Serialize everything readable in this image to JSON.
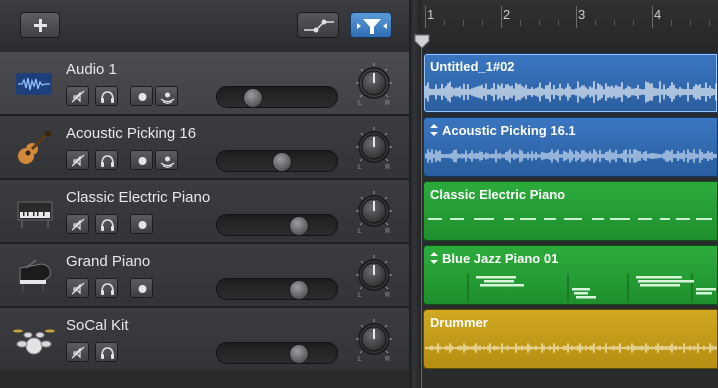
{
  "header": {
    "add_icon": "plus-icon",
    "automation_icon": "automation-curve-icon",
    "smart_controls_icon": "smart-controls-icon"
  },
  "ruler": {
    "bars": [
      "1",
      "2",
      "3",
      "4"
    ]
  },
  "tracks": [
    {
      "name": "Audio 1",
      "icon": "audio-waveform-icon",
      "selected": true,
      "volume": 0.25,
      "pan": "center"
    },
    {
      "name": "Acoustic Picking 16",
      "icon": "acoustic-guitar-icon",
      "selected": false,
      "volume": 0.55,
      "pan": "center"
    },
    {
      "name": "Classic Electric Piano",
      "icon": "electric-piano-icon",
      "selected": false,
      "volume": 0.72,
      "pan": "center"
    },
    {
      "name": "Grand Piano",
      "icon": "grand-piano-icon",
      "selected": false,
      "volume": 0.72,
      "pan": "center"
    },
    {
      "name": "SoCal Kit",
      "icon": "drum-kit-icon",
      "selected": false,
      "volume": 0.72,
      "pan": "center"
    }
  ],
  "regions": [
    {
      "title": "Untitled_1#02",
      "color": "#3a76c0",
      "kind": "audio"
    },
    {
      "title": "Acoustic Picking 16.1",
      "color": "#3a76c0",
      "kind": "loop"
    },
    {
      "title": "Classic Electric Piano",
      "color": "#2cac3c",
      "kind": "midi"
    },
    {
      "title": "Blue Jazz Piano 01",
      "color": "#2cac3c",
      "kind": "loop"
    },
    {
      "title": "Drummer",
      "color": "#d0a820",
      "kind": "drummer"
    }
  ],
  "pan_labels": {
    "left": "L",
    "right": "R"
  },
  "accent_color": "#4a90e2"
}
